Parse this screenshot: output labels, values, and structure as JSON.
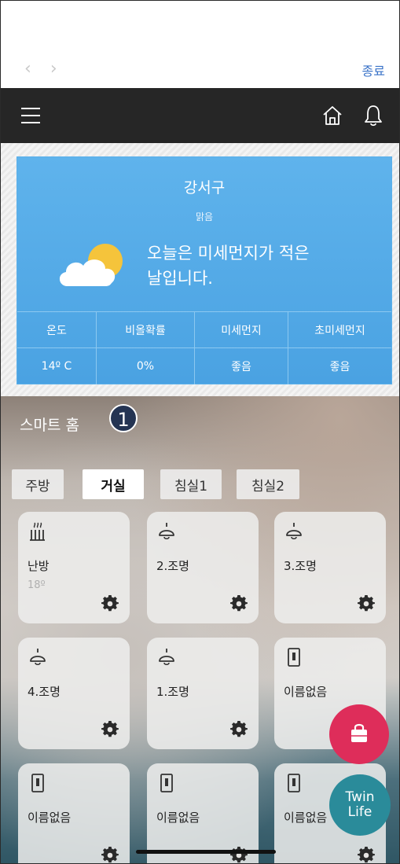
{
  "browser": {
    "back": "‹",
    "forward": "›",
    "close_label": "종료"
  },
  "header": {
    "menu_icon": "hamburger-icon",
    "home_icon": "home-icon",
    "bell_icon": "bell-icon"
  },
  "weather": {
    "city": "강서구",
    "condition": "맑음",
    "message_line1": "오늘은 미세먼지가 적은",
    "message_line2": "날입니다.",
    "icon": "partly-cloudy-icon",
    "headers": [
      "온도",
      "비올확률",
      "미세먼지",
      "초미세먼지"
    ],
    "values": [
      "14º C",
      "0%",
      "좋음",
      "좋음"
    ]
  },
  "smart_home": {
    "title": "스마트 홈",
    "badge": "1",
    "tabs": [
      "주방",
      "거실",
      "침실1",
      "침실2"
    ],
    "active_tab": "거실",
    "tiles": [
      {
        "label": "난방",
        "sub": "18º",
        "icon": "heater-icon"
      },
      {
        "label": "2.조명",
        "sub": "",
        "icon": "lamp-icon"
      },
      {
        "label": "3.조명",
        "sub": "",
        "icon": "lamp-icon"
      },
      {
        "label": "4.조명",
        "sub": "",
        "icon": "lamp-icon"
      },
      {
        "label": "1.조명",
        "sub": "",
        "icon": "lamp-icon"
      },
      {
        "label": "이름없음",
        "sub": "",
        "icon": "switch-icon"
      },
      {
        "label": "이름없음",
        "sub": "",
        "icon": "switch-icon"
      },
      {
        "label": "이름없음",
        "sub": "",
        "icon": "switch-icon"
      },
      {
        "label": "이름없음",
        "sub": "",
        "icon": "switch-icon"
      }
    ]
  },
  "fab": {
    "shop_icon": "shopping-bag-icon",
    "twin_line1": "Twin",
    "twin_line2": "Life"
  },
  "colors": {
    "weather_blue": "#4aa2e2",
    "header_dark": "#262626",
    "shop_red": "#de2d5a",
    "twin_teal": "#2a8b9a",
    "badge_navy": "#243453"
  }
}
